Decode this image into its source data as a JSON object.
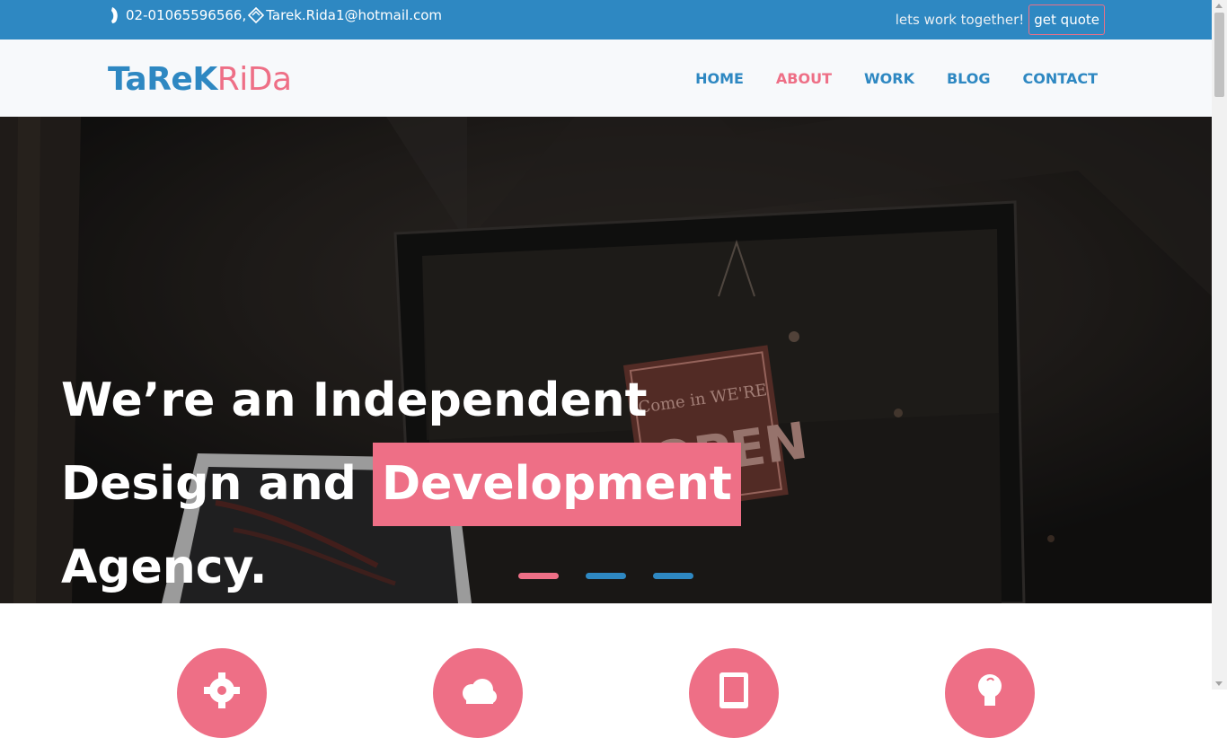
{
  "colors": {
    "blue": "#2e88c2",
    "pink": "#ee6f86"
  },
  "topbar": {
    "phone": "02-01065596566,",
    "email": "Tarek.Rida1@hotmail.com",
    "tagline": "lets work together!",
    "quote_label": "get quote"
  },
  "logo": {
    "part1": "TaReK",
    "part2": "RiDa"
  },
  "nav": {
    "items": [
      {
        "label": "HOME"
      },
      {
        "label": "ABOUT"
      },
      {
        "label": "WORK"
      },
      {
        "label": "BLOG"
      },
      {
        "label": "CONTACT"
      }
    ],
    "active": "ABOUT"
  },
  "hero": {
    "line1": "We’re an Independent",
    "line2_prefix": "Design and",
    "line2_highlight": "Development",
    "line3": "Agency.",
    "sign_text_1": "Come in WE'RE",
    "sign_text_2": "OPEN",
    "carousel_active": 1,
    "carousel_count": 3
  },
  "services": {
    "icons": [
      "gear-icon",
      "cloud-icon",
      "tablet-icon",
      "lightbulb-icon"
    ]
  }
}
